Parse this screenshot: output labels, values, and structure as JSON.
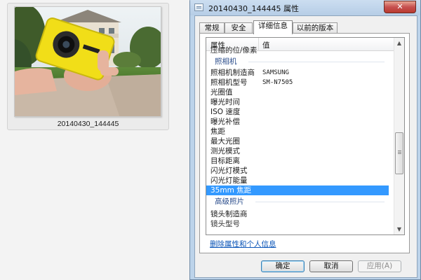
{
  "explorer": {
    "thumbnail_caption": "20140430_144445"
  },
  "dialog": {
    "title": "20140430_144445 属性",
    "close_glyph": "✕",
    "tabs": [
      {
        "label": "常规"
      },
      {
        "label": "安全"
      },
      {
        "label": "详细信息",
        "active": true
      },
      {
        "label": "以前的版本"
      }
    ],
    "columns": {
      "property": "属性",
      "value": "值"
    },
    "clipped_row": "压缩的位/像素",
    "groups": {
      "camera": "照相机",
      "advanced": "高级照片"
    },
    "camera_rows": [
      {
        "name": "照相机制造商",
        "value": "SAMSUNG"
      },
      {
        "name": "照相机型号",
        "value": "SM-N7505"
      },
      {
        "name": "光圈值",
        "value": ""
      },
      {
        "name": "曝光时间",
        "value": ""
      },
      {
        "name": "ISO 速度",
        "value": ""
      },
      {
        "name": "曝光补偿",
        "value": ""
      },
      {
        "name": "焦距",
        "value": ""
      },
      {
        "name": "最大光圈",
        "value": ""
      },
      {
        "name": "测光模式",
        "value": ""
      },
      {
        "name": "目标距离",
        "value": ""
      },
      {
        "name": "闪光灯模式",
        "value": ""
      },
      {
        "name": "闪光灯能量",
        "value": ""
      },
      {
        "name": "35mm 焦距",
        "value": "",
        "selected": true
      }
    ],
    "advanced_rows": [
      {
        "name": "镜头制造商",
        "value": ""
      },
      {
        "name": "镜头型号",
        "value": ""
      }
    ],
    "remove_link": "删除属性和个人信息",
    "buttons": {
      "ok": "确定",
      "cancel": "取消",
      "apply": "应用(A)"
    },
    "colors": {
      "selection": "#3399ff",
      "link": "#0b55b8",
      "group_label": "#2c4e8c"
    }
  }
}
